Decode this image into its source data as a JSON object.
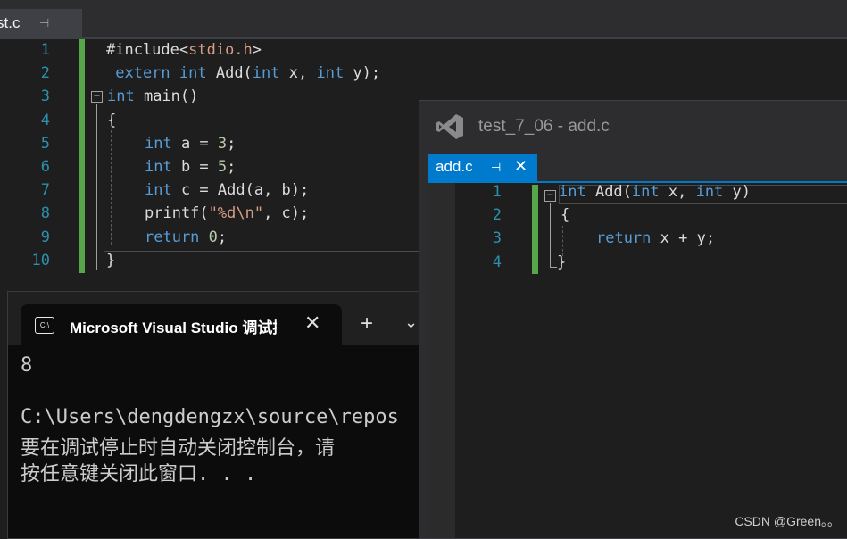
{
  "main_editor": {
    "tab": {
      "label": "st.c",
      "pin_icon": "pin-icon",
      "close_icon": "close-icon"
    },
    "line_numbers": [
      "1",
      "2",
      "3",
      "4",
      "5",
      "6",
      "7",
      "8",
      "9",
      "10"
    ],
    "lines": [
      [
        {
          "t": "#include<",
          "c": "plain"
        },
        {
          "t": "stdio.h",
          "c": "inc"
        },
        {
          "t": ">",
          "c": "plain"
        }
      ],
      [
        {
          "t": " extern ",
          "c": "kw"
        },
        {
          "t": "int ",
          "c": "kw"
        },
        {
          "t": "Add(",
          "c": "plain"
        },
        {
          "t": "int ",
          "c": "kw"
        },
        {
          "t": "x, ",
          "c": "plain"
        },
        {
          "t": "int ",
          "c": "kw"
        },
        {
          "t": "y);",
          "c": "plain"
        }
      ],
      [
        {
          "t": "int ",
          "c": "kw"
        },
        {
          "t": "main()",
          "c": "plain"
        }
      ],
      [
        {
          "t": "{",
          "c": "plain"
        }
      ],
      [
        {
          "t": "int ",
          "c": "kw"
        },
        {
          "t": "a = ",
          "c": "plain"
        },
        {
          "t": "3",
          "c": "num"
        },
        {
          "t": ";",
          "c": "plain"
        }
      ],
      [
        {
          "t": "int ",
          "c": "kw"
        },
        {
          "t": "b = ",
          "c": "plain"
        },
        {
          "t": "5",
          "c": "num"
        },
        {
          "t": ";",
          "c": "plain"
        }
      ],
      [
        {
          "t": "int ",
          "c": "kw"
        },
        {
          "t": "c = Add(a, b);",
          "c": "plain"
        }
      ],
      [
        {
          "t": "printf(",
          "c": "plain"
        },
        {
          "t": "\"%d\\n\"",
          "c": "str"
        },
        {
          "t": ", c);",
          "c": "plain"
        }
      ],
      [
        {
          "t": "return ",
          "c": "kw"
        },
        {
          "t": "0",
          "c": "num"
        },
        {
          "t": ";",
          "c": "plain"
        }
      ],
      [
        {
          "t": "}",
          "c": "plain"
        }
      ]
    ]
  },
  "console": {
    "tab_icon_text": "C:\\",
    "title": "Microsoft Visual Studio 调试控制台",
    "close_icon": "close-icon",
    "new_tab_icon": "plus-icon",
    "dropdown_icon": "chevron-down-icon",
    "output": [
      "8",
      "",
      "C:\\Users\\dengdengzx\\source\\repos",
      "要在调试停止时自动关闭控制台，请",
      "按任意键关闭此窗口. . ."
    ]
  },
  "add_window": {
    "title": "test_7_06 - add.c",
    "tab": {
      "label": "add.c",
      "pin_icon": "pin-icon",
      "close_icon": "close-icon"
    },
    "line_numbers": [
      "1",
      "2",
      "3",
      "4"
    ],
    "lines": [
      [
        {
          "t": "int ",
          "c": "kw"
        },
        {
          "t": "Add(",
          "c": "plain"
        },
        {
          "t": "int ",
          "c": "kw"
        },
        {
          "t": "x, ",
          "c": "plain"
        },
        {
          "t": "int ",
          "c": "kw"
        },
        {
          "t": "y)",
          "c": "plain"
        }
      ],
      [
        {
          "t": "{",
          "c": "plain"
        }
      ],
      [
        {
          "t": "return ",
          "c": "kw"
        },
        {
          "t": "x + y;",
          "c": "plain"
        }
      ],
      [
        {
          "t": "}",
          "c": "plain"
        }
      ]
    ]
  },
  "watermark": "CSDN @Green。。",
  "colors": {
    "keyword": "#569cd6",
    "string": "#d69d85",
    "number": "#b5cea8",
    "line_number": "#2b91af",
    "accent": "#007acc",
    "change_bar": "#57a64a"
  }
}
